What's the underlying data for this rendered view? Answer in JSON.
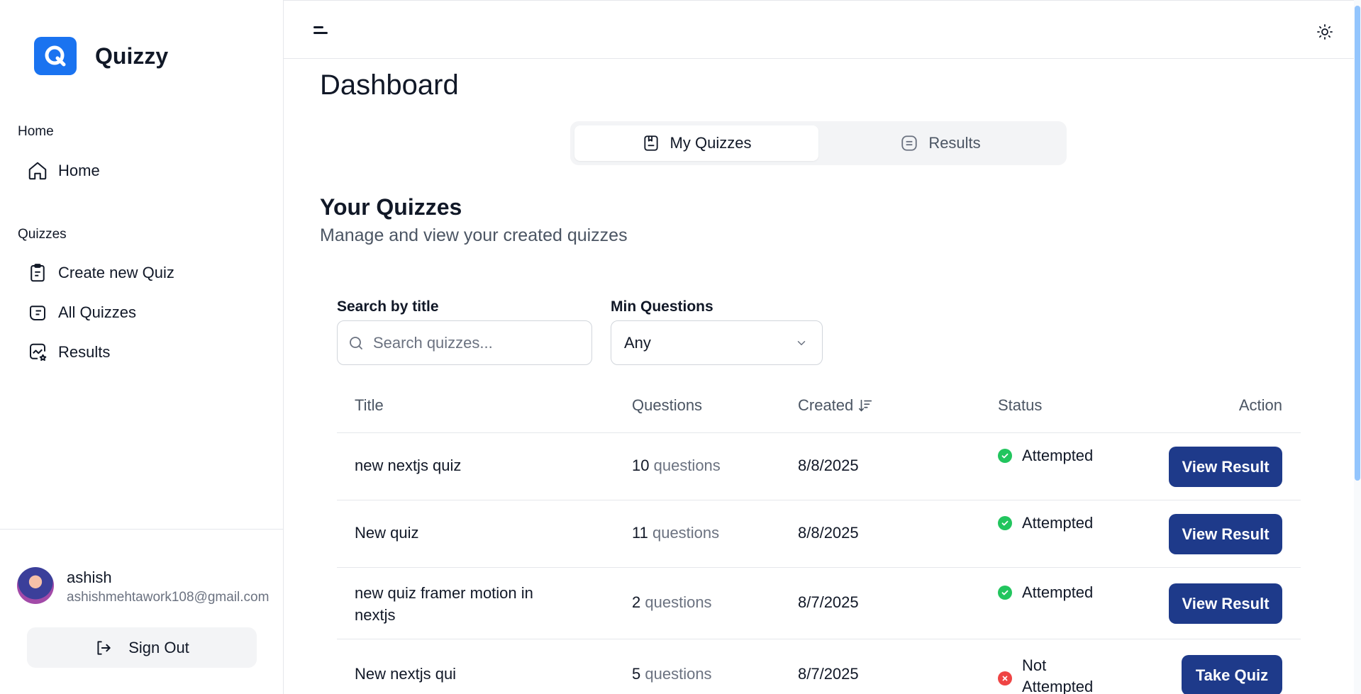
{
  "app": {
    "name": "Quizzy",
    "logo_letter": "Q",
    "accent_color": "#1a73f0",
    "button_color": "#1e3a8a"
  },
  "sidebar": {
    "groups": [
      {
        "label": "Home",
        "items": [
          {
            "label": "Home",
            "icon": "home-icon"
          }
        ]
      },
      {
        "label": "Quizzes",
        "items": [
          {
            "label": "Create new Quiz",
            "icon": "clipboard-icon"
          },
          {
            "label": "All Quizzes",
            "icon": "quiz-stack-icon"
          },
          {
            "label": "Results",
            "icon": "chart-badge-icon"
          }
        ]
      }
    ],
    "user": {
      "name": "ashish",
      "email": "ashishmehtawork108@gmail.com"
    },
    "signout_label": "Sign Out"
  },
  "topbar": {
    "menu_icon": "sidebar-toggle-icon",
    "theme_icon": "sun-icon"
  },
  "main": {
    "title": "Dashboard",
    "tabs": [
      {
        "label": "My Quizzes",
        "icon": "notebook-icon",
        "active": true
      },
      {
        "label": "Results",
        "icon": "list-box-icon",
        "active": false
      }
    ],
    "section_title": "Your Quizzes",
    "section_subtitle": "Manage and view your created quizzes",
    "filters": {
      "search_label": "Search by title",
      "search_placeholder": "Search quizzes...",
      "min_label": "Min Questions",
      "min_value": "Any"
    },
    "table": {
      "headers": {
        "title": "Title",
        "questions": "Questions",
        "created": "Created",
        "status": "Status",
        "action": "Action"
      },
      "rows": [
        {
          "title": "new nextjs quiz",
          "count": "10",
          "unit": "questions",
          "created": "8/8/2025",
          "status": "Attempted",
          "status_type": "success",
          "action": "View Result"
        },
        {
          "title": "New quiz",
          "count": "11",
          "unit": "questions",
          "created": "8/8/2025",
          "status": "Attempted",
          "status_type": "success",
          "action": "View Result"
        },
        {
          "title": "new quiz framer motion in nextjs",
          "count": "2",
          "unit": "questions",
          "created": "8/7/2025",
          "status": "Attempted",
          "status_type": "success",
          "action": "View Result"
        },
        {
          "title": "New nextjs qui",
          "count": "5",
          "unit": "questions",
          "created": "8/7/2025",
          "status": "Not Attempted",
          "status_type": "error",
          "action": "Take Quiz"
        }
      ]
    }
  }
}
